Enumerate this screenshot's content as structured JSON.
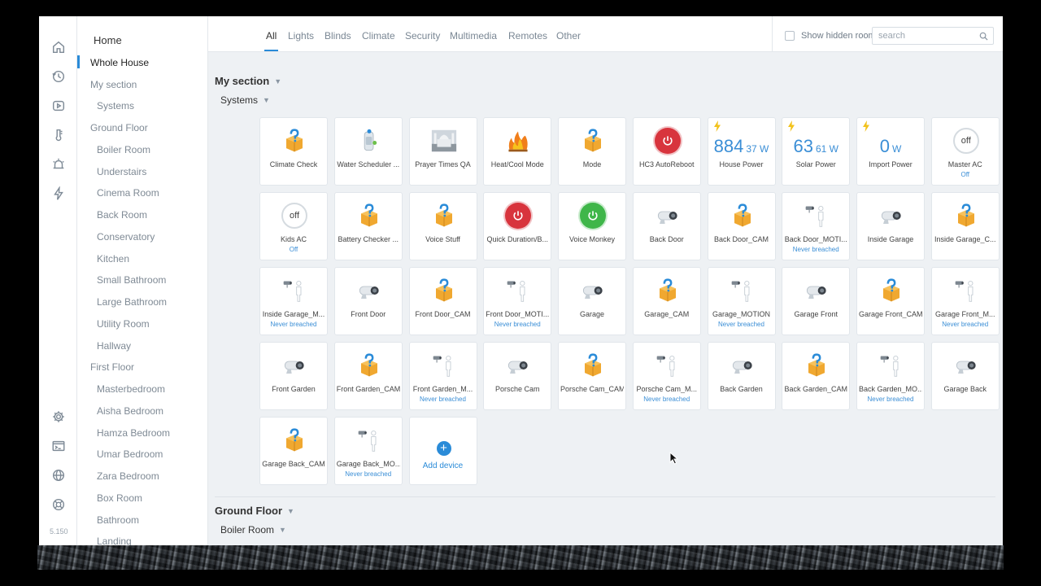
{
  "app": {
    "version": "5.150"
  },
  "rail": {
    "items": [
      {
        "name": "home-icon",
        "icon": "home"
      },
      {
        "name": "history-icon",
        "icon": "history"
      },
      {
        "name": "scenes-icon",
        "icon": "play"
      },
      {
        "name": "climate-icon",
        "icon": "thermometer"
      },
      {
        "name": "alarm-icon",
        "icon": "alarm"
      },
      {
        "name": "energy-icon",
        "icon": "bolt"
      },
      {
        "name": "settings-icon",
        "icon": "gear"
      },
      {
        "name": "terminal-icon",
        "icon": "terminal"
      },
      {
        "name": "connection-icon",
        "icon": "globe"
      },
      {
        "name": "support-icon",
        "icon": "lifebuoy"
      }
    ]
  },
  "rooms": [
    {
      "label": "Home",
      "level": 0
    },
    {
      "label": "Whole House",
      "level": 1,
      "active": true
    },
    {
      "label": "My section",
      "level": 1
    },
    {
      "label": "Systems",
      "level": 2
    },
    {
      "label": "Ground Floor",
      "level": 1
    },
    {
      "label": "Boiler Room",
      "level": 2
    },
    {
      "label": "Understairs",
      "level": 2
    },
    {
      "label": "Cinema Room",
      "level": 2
    },
    {
      "label": "Back Room",
      "level": 2
    },
    {
      "label": "Conservatory",
      "level": 2
    },
    {
      "label": "Kitchen",
      "level": 2
    },
    {
      "label": "Small Bathroom",
      "level": 2
    },
    {
      "label": "Large Bathroom",
      "level": 2
    },
    {
      "label": "Utility Room",
      "level": 2
    },
    {
      "label": "Hallway",
      "level": 2
    },
    {
      "label": "First Floor",
      "level": 1
    },
    {
      "label": "Masterbedroom",
      "level": 2
    },
    {
      "label": "Aisha Bedroom",
      "level": 2
    },
    {
      "label": "Hamza Bedroom",
      "level": 2
    },
    {
      "label": "Umar Bedroom",
      "level": 2
    },
    {
      "label": "Zara Bedroom",
      "level": 2
    },
    {
      "label": "Box Room",
      "level": 2
    },
    {
      "label": "Bathroom",
      "level": 2
    },
    {
      "label": "Landing",
      "level": 2
    }
  ],
  "tabs": [
    {
      "label": "All",
      "active": true
    },
    {
      "label": "Lights"
    },
    {
      "label": "Blinds"
    },
    {
      "label": "Climate"
    },
    {
      "label": "Security"
    },
    {
      "label": "Multimedia"
    },
    {
      "label": "Remotes"
    },
    {
      "label": "Other"
    }
  ],
  "toolbar": {
    "show_hidden_label": "Show hidden rooms",
    "search_placeholder": "search"
  },
  "sections": {
    "my_section": "My section",
    "systems": "Systems",
    "ground_floor": "Ground Floor",
    "boiler_room": "Boiler Room"
  },
  "colors": {
    "accent": "#2a8bd8",
    "link_blue": "#3a8ed6",
    "power_red": "#d8343d",
    "power_green": "#3fb649",
    "bolt_yellow": "#f2c21b"
  },
  "devices": [
    {
      "label": "Climate Check",
      "icon": "qa-box"
    },
    {
      "label": "Water Scheduler ...",
      "icon": "water-boiler"
    },
    {
      "label": "Prayer Times QA",
      "icon": "mosque"
    },
    {
      "label": "Heat/Cool Mode",
      "icon": "flame"
    },
    {
      "label": "Mode",
      "icon": "qa-box"
    },
    {
      "label": "HC3 AutoReboot",
      "icon": "power-red"
    },
    {
      "label": "House Power",
      "icon": "meter",
      "value": "884",
      "unit": "37 W"
    },
    {
      "label": "Solar Power",
      "icon": "meter",
      "value": "63",
      "unit": "61 W"
    },
    {
      "label": "Import Power",
      "icon": "meter",
      "value": "0",
      "unit": "W"
    },
    {
      "label": "Master AC",
      "icon": "off",
      "sub": "Off",
      "state": "off"
    },
    {
      "label": "Kids AC",
      "icon": "off",
      "sub": "Off",
      "state": "off"
    },
    {
      "label": "Battery Checker ...",
      "icon": "qa-box"
    },
    {
      "label": "Voice Stuff",
      "icon": "qa-box"
    },
    {
      "label": "Quick Duration/B...",
      "icon": "power-red"
    },
    {
      "label": "Voice Monkey",
      "icon": "power-green"
    },
    {
      "label": "Back Door",
      "icon": "camera"
    },
    {
      "label": "Back Door_CAM",
      "icon": "qa-box"
    },
    {
      "label": "Back Door_MOTI...",
      "icon": "motion",
      "sub": "Never breached"
    },
    {
      "label": "Inside Garage",
      "icon": "camera"
    },
    {
      "label": "Inside Garage_C...",
      "icon": "qa-box"
    },
    {
      "label": "Inside Garage_M...",
      "icon": "motion",
      "sub": "Never breached"
    },
    {
      "label": "Front Door",
      "icon": "camera"
    },
    {
      "label": "Front Door_CAM",
      "icon": "qa-box"
    },
    {
      "label": "Front Door_MOTI...",
      "icon": "motion",
      "sub": "Never breached"
    },
    {
      "label": "Garage",
      "icon": "camera"
    },
    {
      "label": "Garage_CAM",
      "icon": "qa-box"
    },
    {
      "label": "Garage_MOTION",
      "icon": "motion",
      "sub": "Never breached"
    },
    {
      "label": "Garage Front",
      "icon": "camera"
    },
    {
      "label": "Garage Front_CAM",
      "icon": "qa-box"
    },
    {
      "label": "Garage Front_M...",
      "icon": "motion",
      "sub": "Never breached"
    },
    {
      "label": "Front Garden",
      "icon": "camera"
    },
    {
      "label": "Front Garden_CAM",
      "icon": "qa-box"
    },
    {
      "label": "Front Garden_M...",
      "icon": "motion",
      "sub": "Never breached"
    },
    {
      "label": "Porsche Cam",
      "icon": "camera"
    },
    {
      "label": "Porsche Cam_CAM",
      "icon": "qa-box"
    },
    {
      "label": "Porsche Cam_M...",
      "icon": "motion",
      "sub": "Never breached"
    },
    {
      "label": "Back Garden",
      "icon": "camera"
    },
    {
      "label": "Back Garden_CAM",
      "icon": "qa-box"
    },
    {
      "label": "Back Garden_MO...",
      "icon": "motion",
      "sub": "Never breached"
    },
    {
      "label": "Garage Back",
      "icon": "camera"
    },
    {
      "label": "Garage Back_CAM",
      "icon": "qa-box"
    },
    {
      "label": "Garage Back_MO...",
      "icon": "motion",
      "sub": "Never breached"
    }
  ],
  "add_device": {
    "label": "Add device",
    "plus": "+"
  },
  "boiler_room_devices": [
    {
      "icon": "power-green"
    },
    {
      "icon": "power-red"
    },
    {
      "icon": "power-red"
    },
    {
      "icon": "thermometer"
    },
    {
      "icon": "thermometer"
    },
    {
      "icon": "thermometer"
    },
    {
      "icon": "blank"
    }
  ]
}
